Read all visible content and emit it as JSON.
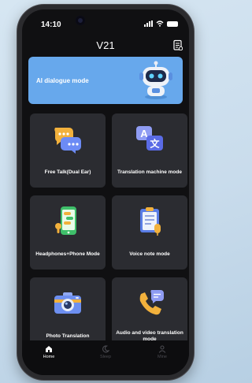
{
  "status_bar": {
    "time": "14:10"
  },
  "header": {
    "title": "V21",
    "menu_icon": "clipboard-list-icon"
  },
  "banner": {
    "label": "AI dialogue mode",
    "icon": "robot-icon",
    "color": "#67a8ec"
  },
  "cards": [
    {
      "label": "Free Talk(Dual Ear)",
      "icon": "chat-bubbles-icon"
    },
    {
      "label": "Translation machine mode",
      "icon": "translate-icon"
    },
    {
      "label": "Headphones+Phone Mode",
      "icon": "phone-chat-icon"
    },
    {
      "label": "Voice note mode",
      "icon": "clipboard-note-icon"
    },
    {
      "label": "Photo Translation",
      "icon": "camera-icon"
    },
    {
      "label": "Audio and video translation mode",
      "icon": "phone-call-icon"
    }
  ],
  "tabs": [
    {
      "label": "Home",
      "icon": "home-icon",
      "active": true
    },
    {
      "label": "Sleep",
      "icon": "moon-icon",
      "active": false
    },
    {
      "label": "Mine",
      "icon": "person-icon",
      "active": false
    }
  ]
}
